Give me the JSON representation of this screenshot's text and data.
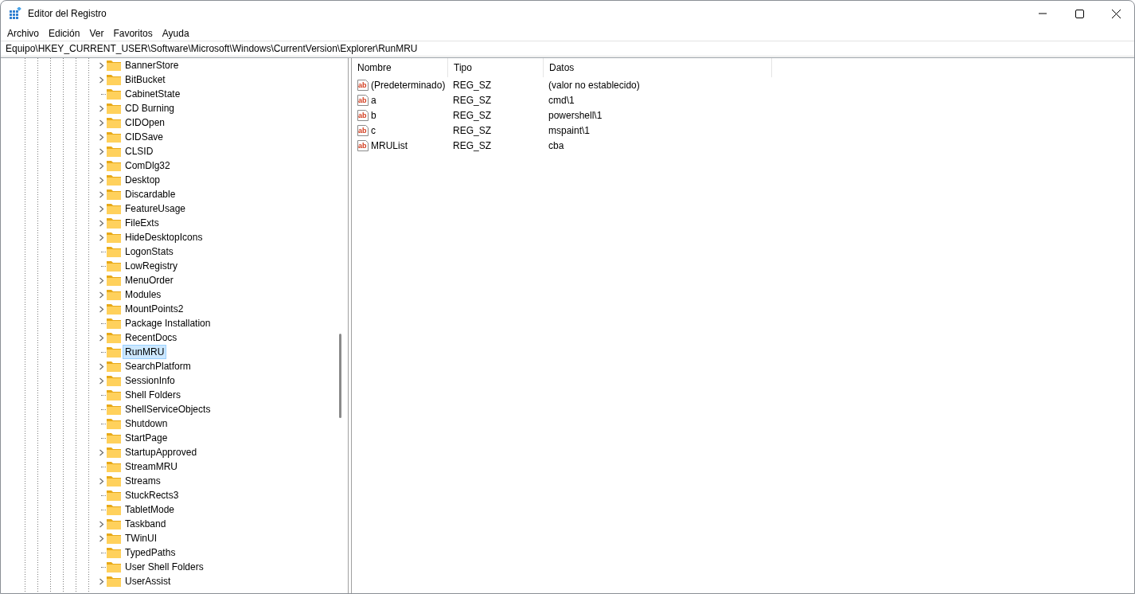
{
  "window": {
    "title": "Editor del Registro"
  },
  "menu": [
    "Archivo",
    "Edición",
    "Ver",
    "Favoritos",
    "Ayuda"
  ],
  "address": "Equipo\\HKEY_CURRENT_USER\\Software\\Microsoft\\Windows\\CurrentVersion\\Explorer\\RunMRU",
  "tree": [
    {
      "label": "BannerStore",
      "expandable": true,
      "selected": false
    },
    {
      "label": "BitBucket",
      "expandable": true,
      "selected": false
    },
    {
      "label": "CabinetState",
      "expandable": false,
      "selected": false
    },
    {
      "label": "CD Burning",
      "expandable": true,
      "selected": false
    },
    {
      "label": "CIDOpen",
      "expandable": true,
      "selected": false
    },
    {
      "label": "CIDSave",
      "expandable": true,
      "selected": false
    },
    {
      "label": "CLSID",
      "expandable": true,
      "selected": false
    },
    {
      "label": "ComDlg32",
      "expandable": true,
      "selected": false
    },
    {
      "label": "Desktop",
      "expandable": true,
      "selected": false
    },
    {
      "label": "Discardable",
      "expandable": true,
      "selected": false
    },
    {
      "label": "FeatureUsage",
      "expandable": true,
      "selected": false
    },
    {
      "label": "FileExts",
      "expandable": true,
      "selected": false
    },
    {
      "label": "HideDesktopIcons",
      "expandable": true,
      "selected": false
    },
    {
      "label": "LogonStats",
      "expandable": false,
      "selected": false
    },
    {
      "label": "LowRegistry",
      "expandable": false,
      "selected": false
    },
    {
      "label": "MenuOrder",
      "expandable": true,
      "selected": false
    },
    {
      "label": "Modules",
      "expandable": true,
      "selected": false
    },
    {
      "label": "MountPoints2",
      "expandable": true,
      "selected": false
    },
    {
      "label": "Package Installation",
      "expandable": false,
      "selected": false
    },
    {
      "label": "RecentDocs",
      "expandable": true,
      "selected": false
    },
    {
      "label": "RunMRU",
      "expandable": false,
      "selected": true
    },
    {
      "label": "SearchPlatform",
      "expandable": true,
      "selected": false
    },
    {
      "label": "SessionInfo",
      "expandable": true,
      "selected": false
    },
    {
      "label": "Shell Folders",
      "expandable": false,
      "selected": false
    },
    {
      "label": "ShellServiceObjects",
      "expandable": false,
      "selected": false
    },
    {
      "label": "Shutdown",
      "expandable": false,
      "selected": false
    },
    {
      "label": "StartPage",
      "expandable": false,
      "selected": false
    },
    {
      "label": "StartupApproved",
      "expandable": true,
      "selected": false
    },
    {
      "label": "StreamMRU",
      "expandable": false,
      "selected": false
    },
    {
      "label": "Streams",
      "expandable": true,
      "selected": false
    },
    {
      "label": "StuckRects3",
      "expandable": false,
      "selected": false
    },
    {
      "label": "TabletMode",
      "expandable": false,
      "selected": false
    },
    {
      "label": "Taskband",
      "expandable": true,
      "selected": false
    },
    {
      "label": "TWinUI",
      "expandable": true,
      "selected": false
    },
    {
      "label": "TypedPaths",
      "expandable": false,
      "selected": false
    },
    {
      "label": "User Shell Folders",
      "expandable": false,
      "selected": false
    },
    {
      "label": "UserAssist",
      "expandable": true,
      "selected": false
    }
  ],
  "table": {
    "columns": [
      "Nombre",
      "Tipo",
      "Datos"
    ],
    "rows": [
      {
        "icon": "ab",
        "cells": [
          "(Predeterminado)",
          "REG_SZ",
          "(valor no establecido)"
        ]
      },
      {
        "icon": "ab",
        "cells": [
          "a",
          "REG_SZ",
          "cmd\\1"
        ]
      },
      {
        "icon": "ab",
        "cells": [
          "b",
          "REG_SZ",
          "powershell\\1"
        ]
      },
      {
        "icon": "ab",
        "cells": [
          "c",
          "REG_SZ",
          "mspaint\\1"
        ]
      },
      {
        "icon": "ab",
        "cells": [
          "MRUList",
          "REG_SZ",
          "cba"
        ]
      }
    ]
  }
}
